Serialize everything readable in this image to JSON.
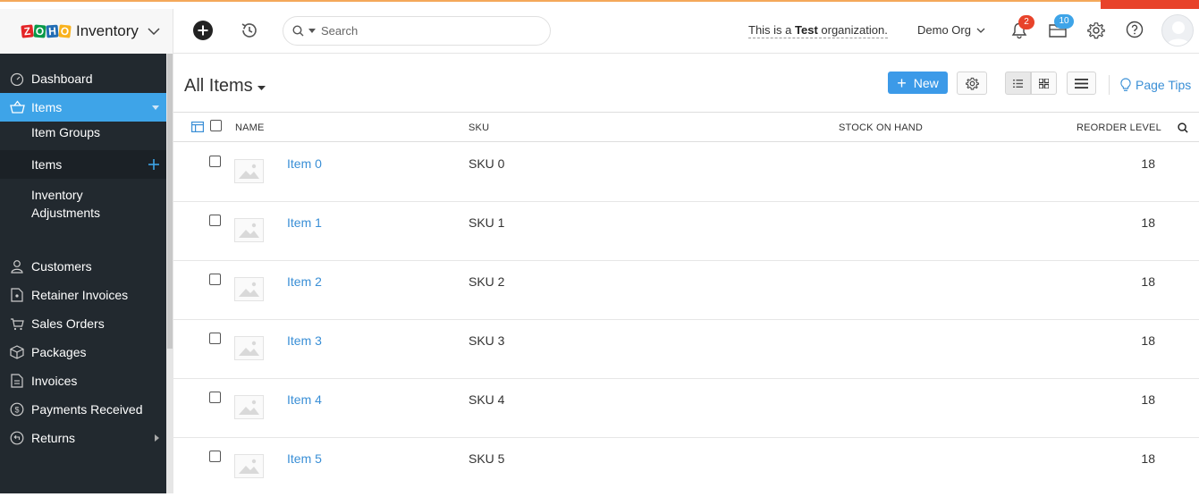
{
  "brand": {
    "name": "Inventory"
  },
  "search": {
    "placeholder": "Search"
  },
  "org": {
    "test_prefix": "This is a ",
    "test_word": "Test",
    "test_suffix": " organization.",
    "name": "Demo Org"
  },
  "notifications": {
    "bell_count": "2",
    "updates_count": "10"
  },
  "colors": {
    "accent": "#3ea4e8",
    "sidebar": "#22292f",
    "link": "#3a8fd6",
    "badge_red": "#e8432a",
    "badge_blue": "#3ea4e8"
  },
  "sidebar": {
    "items": [
      {
        "label": "Dashboard",
        "icon": "dashboard-icon"
      },
      {
        "label": "Items",
        "icon": "basket-icon",
        "active": true
      },
      {
        "label": "Customers",
        "icon": "user-icon"
      },
      {
        "label": "Retainer Invoices",
        "icon": "retainer-invoice-icon"
      },
      {
        "label": "Sales Orders",
        "icon": "cart-icon"
      },
      {
        "label": "Packages",
        "icon": "package-icon"
      },
      {
        "label": "Invoices",
        "icon": "invoice-icon"
      },
      {
        "label": "Payments Received",
        "icon": "payment-icon"
      },
      {
        "label": "Returns",
        "icon": "returns-icon"
      }
    ],
    "sub_items": [
      {
        "label": "Item Groups"
      },
      {
        "label": "Items",
        "selected": true
      },
      {
        "label": "Inventory",
        "label2": "Adjustments"
      }
    ]
  },
  "main": {
    "title": "All Items",
    "new_button": "New",
    "page_tips": "Page Tips",
    "columns": {
      "name": "NAME",
      "sku": "SKU",
      "stock": "STOCK ON HAND",
      "reorder": "REORDER LEVEL"
    },
    "rows": [
      {
        "name": "Item 0",
        "sku": "SKU 0",
        "stock": "",
        "reorder": "18"
      },
      {
        "name": "Item 1",
        "sku": "SKU 1",
        "stock": "",
        "reorder": "18"
      },
      {
        "name": "Item 2",
        "sku": "SKU 2",
        "stock": "",
        "reorder": "18"
      },
      {
        "name": "Item 3",
        "sku": "SKU 3",
        "stock": "",
        "reorder": "18"
      },
      {
        "name": "Item 4",
        "sku": "SKU 4",
        "stock": "",
        "reorder": "18"
      },
      {
        "name": "Item 5",
        "sku": "SKU 5",
        "stock": "",
        "reorder": "18"
      }
    ]
  }
}
